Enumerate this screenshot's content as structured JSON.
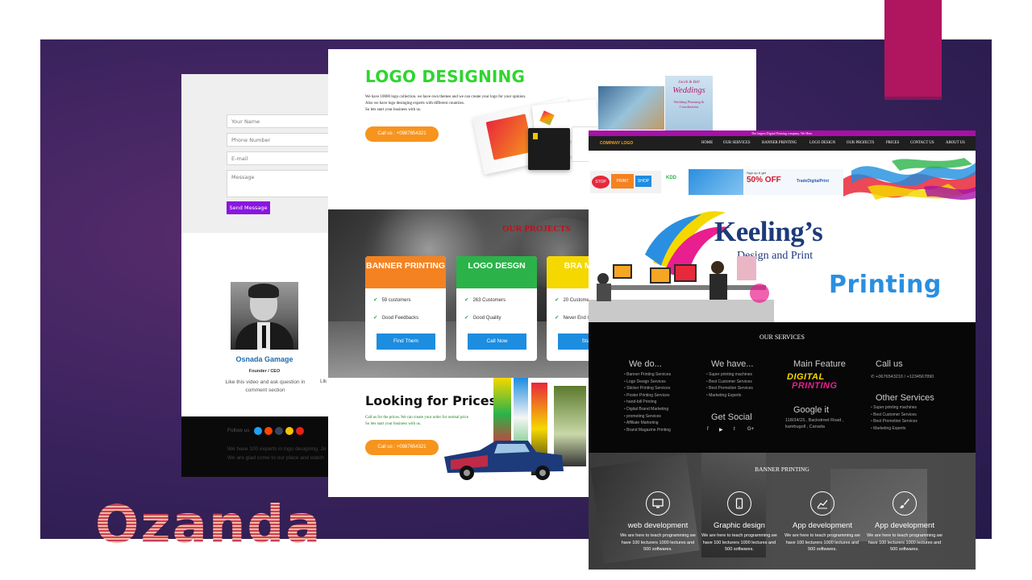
{
  "panel_contact": {
    "form": {
      "name_placeholder": "Your Name",
      "phone_placeholder": "Phone Number",
      "email_placeholder": "E-mail",
      "message_placeholder": "Message",
      "send_label": "Send Message"
    },
    "team": {
      "name": "Osnada Gamage",
      "role": "Founder / CEO",
      "description": "Like this video and ask question in comment section",
      "description_second": "Lik"
    },
    "footer": {
      "follow_label": "Follow us",
      "line1": "We have 100 experts in logo designing. Jo",
      "line2": "We are glad come to our place and watch"
    },
    "colors": {
      "send_button": "#8a16e0",
      "name": "#1e6bb0"
    }
  },
  "panel_logo": {
    "title": "LOGO DESIGNING",
    "text_lines": [
      "We have 10000 logo collection. we have own themes and we can create your logo for your opinion.",
      "Also we have logo desinging experts with different countries.",
      "So lets start your business with us."
    ],
    "call_label": "Call us : +0987654321",
    "weddings_small": "Jacob & Bell",
    "weddings_title": "Weddings",
    "weddings_sub": "Wedding Planning & Coordination",
    "projects": {
      "heading": "OUR PROJECTS",
      "cards": [
        {
          "title": "BANNER PRINTING",
          "color": "#f58220",
          "rows": [
            "59 customers",
            "Good Feedbacks"
          ],
          "button": "Find Them"
        },
        {
          "title": "LOGO DESGN",
          "color": "#2bb34a",
          "rows": [
            "263 Customers",
            "Good Quality"
          ],
          "button": "Call Now"
        },
        {
          "title": "BRA MARK",
          "color": "#f5d800",
          "rows": [
            "20 Custome",
            "Never End O"
          ],
          "button": "Start"
        }
      ]
    },
    "prices": {
      "title": "Looking for Prices",
      "text_lines": [
        "Call us for the prices. We can create your order for normal price",
        "So lets start your business with us."
      ],
      "call_label": "Call us : +0987654321"
    }
  },
  "panel_keelings": {
    "topbar": "The largest Digital Printing company. We Here.",
    "brand": "COMPANY LOGO",
    "nav": [
      "HOME",
      "OUR SERVICES",
      "BANNER PRINTING",
      "LOGO DESIGN",
      "OUR PROJECTS",
      "PRICES",
      "CONTACT US",
      "ABOUT US"
    ],
    "ads": {
      "stop": "STOP",
      "print": "PRINT",
      "shop": "SHOP",
      "offer": "50% OFF",
      "offer_tag": "Sign up & get",
      "trade": "TradeDigitalPrint",
      "logo_small": "KDD"
    },
    "hero": {
      "line1": "Keeling’s",
      "line2": "Design and Print",
      "line3": "Printing"
    },
    "services": {
      "title": "OUR SERVICES",
      "we_do": {
        "heading": "We do...",
        "items": [
          "Banner Printing Services",
          "Logo Design Services",
          "Sticker Printing Services",
          "Poster Printing Services",
          "hand-bill Printing",
          "Digital Brand Marketing",
          "promoting Services",
          "Affiliate Marketing",
          "Brand Magazine Printing"
        ]
      },
      "we_have": {
        "heading": "We have...",
        "items": [
          "Super printing machines",
          "Best Customer Services",
          "Best Promotion Services",
          "Marketing Experts"
        ]
      },
      "get_social": "Get Social",
      "social_icons": [
        "f",
        "▶",
        "t",
        "G+"
      ],
      "main_feature": "Main Feature",
      "feature_logo_line1": "DIGITAL",
      "feature_logo_line2": "PRINTING",
      "google": "Google it",
      "address_line1": "118/34/23., Backstreet Road ,",
      "address_line2": "kambugoll , Canada",
      "call_us": "Call us",
      "phones": "+0676543210 / +1234567890",
      "other": {
        "heading": "Other Services",
        "items": [
          "Super printing machines",
          "Best Customer Services",
          "Best Promotion Services",
          "Marketing Experts"
        ]
      }
    },
    "banner": {
      "title": "BANNER PRINTING",
      "features": [
        {
          "heading": "web development",
          "icon": "monitor-icon",
          "text": "We are here to teach programming.we have 100 lecturers 1000 lectures and 500 softwares."
        },
        {
          "heading": "Graphic design",
          "icon": "tablet-icon",
          "text": "We are here to teach programming.we have 100 lecturers 1000 lectures and 500 softwares."
        },
        {
          "heading": "App development",
          "icon": "chart-icon",
          "text": "We are here to teach programming.we have 100 lecturers 1000 lectures and 500 softwares."
        },
        {
          "heading": "App development",
          "icon": "brush-icon",
          "text": "We are here to teach programming.we have 100 lecturers 1000 lectures and 500 softwares."
        }
      ]
    }
  },
  "wordmark": "Ozanda",
  "colors": {
    "background_band": "#3d2460",
    "accent_tab": "#b0155f",
    "logo_title": "#2fd52f",
    "call_button": "#f7941d",
    "topbar": "#a611a6"
  }
}
